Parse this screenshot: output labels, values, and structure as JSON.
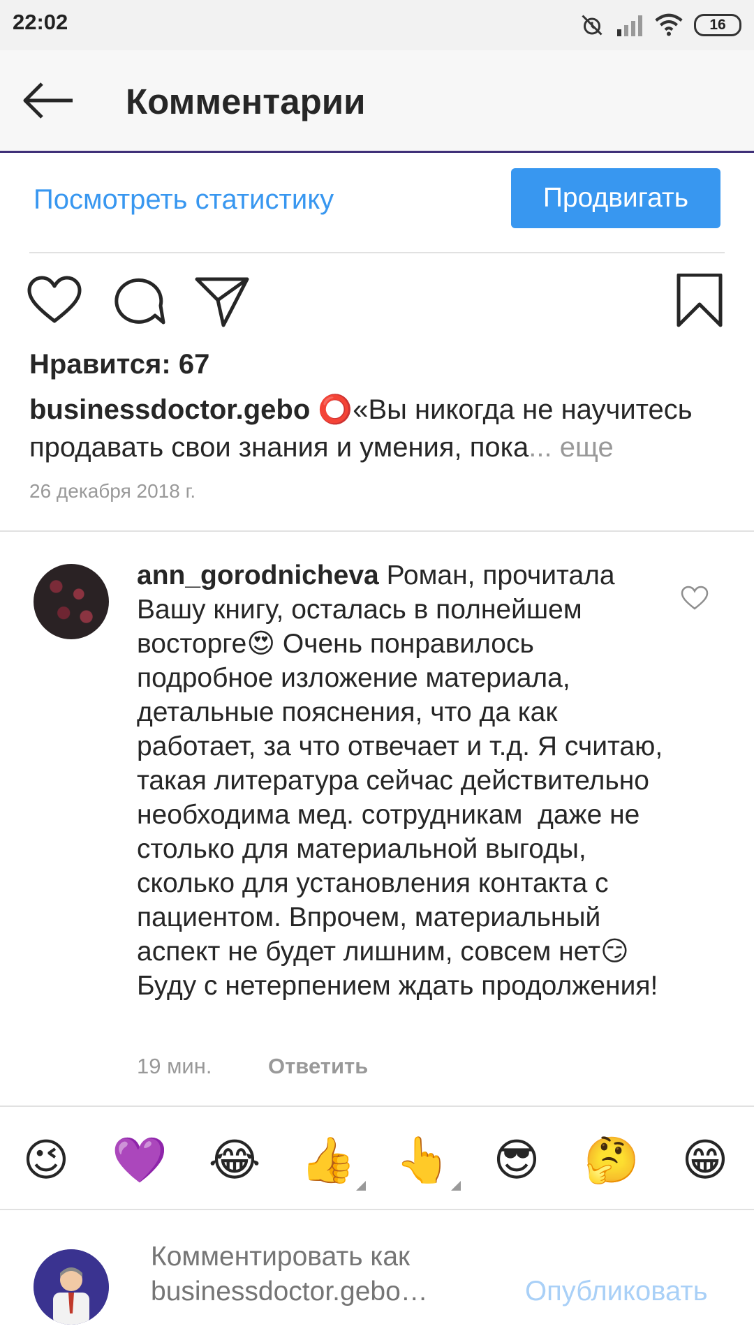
{
  "status_bar": {
    "time": "22:02",
    "battery": "16"
  },
  "header": {
    "title": "Комментарии"
  },
  "stats": {
    "view_label": "Посмотреть статистику",
    "promote_label": "Продвигать"
  },
  "post": {
    "likes": "Нравится: 67",
    "username": "businessdoctor.gebo",
    "caption": "⭕«Вы никогда не научитесь продавать свои знания и умения, пока",
    "more": "... еще",
    "date": "26 декабря 2018 г."
  },
  "comment": {
    "username": "ann_gorodnicheva",
    "text": "Роман, прочитала Вашу книгу, осталась в полнейшем восторге😍 Очень понравилось подробное изложение материала, детальные пояснения, что да как работает, за что отвечает и т.д. Я считаю, такая литература сейчас действительно необходима мед. сотрудникам  даже не столько для материальной выгоды, сколько для установления контакта с пациентом. Впрочем, материальный аспект не будет лишним, совсем нет😏  Буду с нетерпением ждать продолжения!",
    "time": "19 мин.",
    "reply_label": "Ответить"
  },
  "emoji_bar": [
    "😉",
    "💜",
    "😂",
    "👍",
    "👆",
    "😎",
    "🤔",
    "😁"
  ],
  "composer": {
    "placeholder": "Комментировать как businessdoctor.gebo…",
    "publish_label": "Опубликовать"
  },
  "colors": {
    "accent": "#3897f0",
    "header_border": "#3f2f78",
    "muted": "#999999"
  }
}
